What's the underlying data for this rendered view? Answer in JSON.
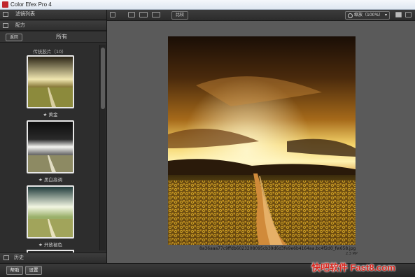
{
  "window": {
    "title": "Color Efex Pro 4"
  },
  "sidebar": {
    "filter_list_label": "滤镜列表",
    "recipes_label": "配方",
    "back_label": "返回",
    "all_label": "所有",
    "group_label": "传统胶片（10）",
    "presets": [
      {
        "label": "★ 黄金"
      },
      {
        "label": "★ 黑白高调"
      },
      {
        "label": "★ 开放褪色"
      }
    ],
    "history_label": "历史"
  },
  "toolbar": {
    "compare_label": "比较",
    "zoom_label": "缩放（100%）"
  },
  "canvas": {
    "filename": "8a36aaa77c9ffdb6023208095cb39d6d3fe9e6b4164aa.bc4f2d0_fw658.jpg",
    "filesize": "2.3 MP"
  },
  "bottom": {
    "help_label": "帮助",
    "settings_label": "设置"
  },
  "watermark": {
    "text": "快吧软件 Fast8.com"
  }
}
